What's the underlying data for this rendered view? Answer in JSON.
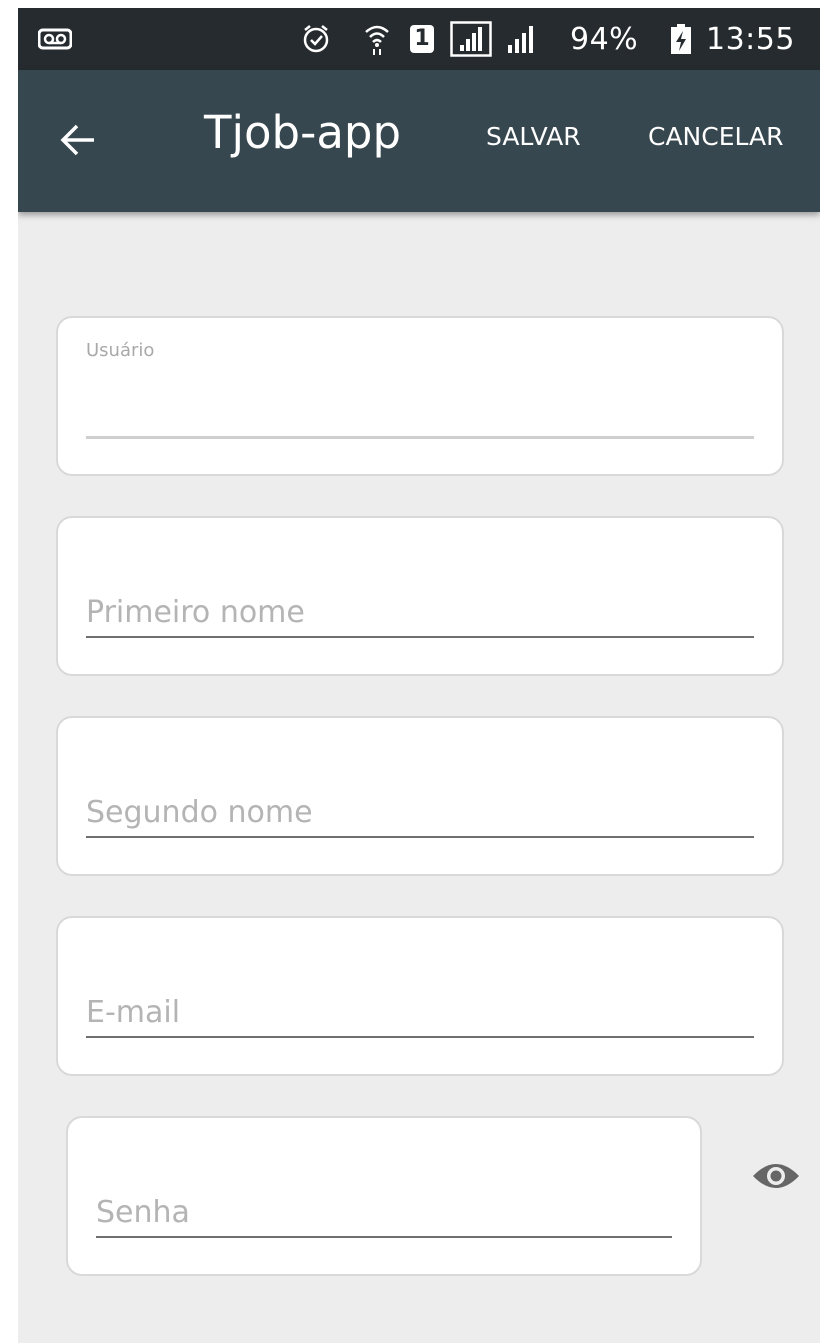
{
  "status_bar": {
    "voicemail_icon": "voicemail-icon",
    "alarm_icon": "alarm-icon",
    "wifi_icon": "wifi-icon",
    "sim_label": "1",
    "battery_percent": "94%",
    "time": "13:55"
  },
  "app_bar": {
    "title": "Tjob-app",
    "save_label": "SALVAR",
    "cancel_label": "CANCELAR",
    "back_icon": "arrow-back-icon"
  },
  "form": {
    "username": {
      "label": "Usuário",
      "value": ""
    },
    "first_name": {
      "placeholder": "Primeiro nome",
      "value": ""
    },
    "last_name": {
      "placeholder": "Segundo nome",
      "value": ""
    },
    "email": {
      "placeholder": "E-mail",
      "value": ""
    },
    "password": {
      "placeholder": "Senha",
      "value": "",
      "toggle_icon": "eye-icon"
    }
  },
  "colors": {
    "status_bar": "#252b2f",
    "app_bar": "#37474f",
    "background": "#ededed",
    "card": "#ffffff"
  }
}
